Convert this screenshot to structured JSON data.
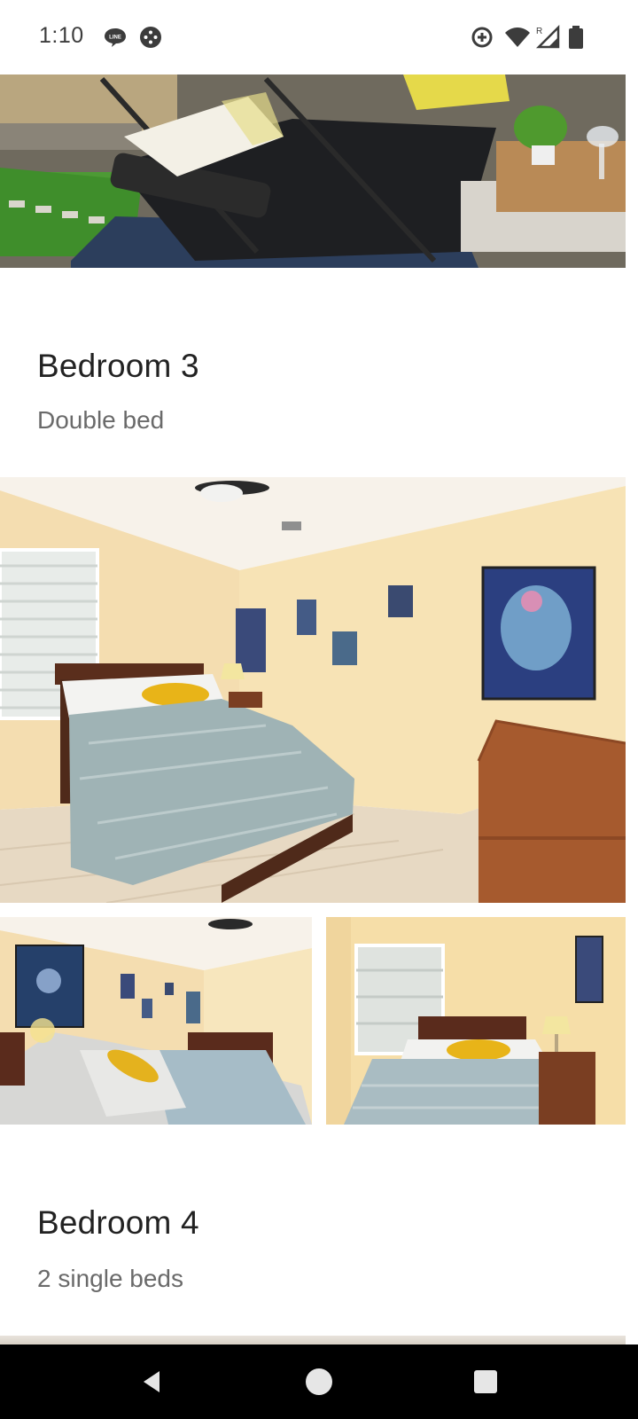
{
  "status_bar": {
    "time": "1:10",
    "icons": [
      "line-icon",
      "game-icon",
      "sync-icon",
      "wifi-icon",
      "signal-icon",
      "battery-icon"
    ],
    "line_badge": "LINE",
    "roaming_label": "R"
  },
  "sections": [
    {
      "title": "Bedroom 3",
      "subtitle": "Double bed"
    },
    {
      "title": "Bedroom 4",
      "subtitle": "2 single beds"
    }
  ],
  "navigation": {
    "buttons": [
      "back",
      "home",
      "recents"
    ]
  },
  "colors": {
    "title": "#222222",
    "subtitle": "#6a6a6a",
    "wall": "#f5dfae",
    "bedspread": "#9fb3b5",
    "wood": "#a65a2e",
    "nav_bar": "#000000"
  }
}
